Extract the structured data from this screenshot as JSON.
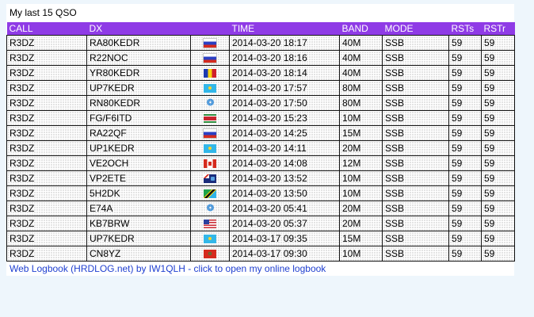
{
  "title": "My last 15 QSO",
  "headers": [
    "CALL",
    "DX",
    "",
    "TIME",
    "BAND",
    "MODE",
    "RSTs",
    "RSTr"
  ],
  "rows": [
    {
      "call": "R3DZ",
      "dx": "RA80KEDR",
      "flag": "flag-russia",
      "time": "2014-03-20 18:17",
      "band": "40M",
      "mode": "SSB",
      "rsts": "59",
      "rstr": "59"
    },
    {
      "call": "R3DZ",
      "dx": "R22NOC",
      "flag": "flag-russia",
      "time": "2014-03-20 18:16",
      "band": "40M",
      "mode": "SSB",
      "rsts": "59",
      "rstr": "59"
    },
    {
      "call": "R3DZ",
      "dx": "YR80KEDR",
      "flag": "flag-romania",
      "time": "2014-03-20 18:14",
      "band": "40M",
      "mode": "SSB",
      "rsts": "59",
      "rstr": "59"
    },
    {
      "call": "R3DZ",
      "dx": "UP7KEDR",
      "flag": "flag-kazakhstan",
      "time": "2014-03-20 17:57",
      "band": "80M",
      "mode": "SSB",
      "rsts": "59",
      "rstr": "59"
    },
    {
      "call": "R3DZ",
      "dx": "RN80KEDR",
      "flag": "flag-un",
      "time": "2014-03-20 17:50",
      "band": "80M",
      "mode": "SSB",
      "rsts": "59",
      "rstr": "59"
    },
    {
      "call": "R3DZ",
      "dx": "FG/F6ITD",
      "flag": "flag-suriname",
      "time": "2014-03-20 15:23",
      "band": "10M",
      "mode": "SSB",
      "rsts": "59",
      "rstr": "59"
    },
    {
      "call": "R3DZ",
      "dx": "RA22QF",
      "flag": "flag-russia",
      "time": "2014-03-20 14:25",
      "band": "15M",
      "mode": "SSB",
      "rsts": "59",
      "rstr": "59"
    },
    {
      "call": "R3DZ",
      "dx": "UP1KEDR",
      "flag": "flag-kazakhstan",
      "time": "2014-03-20 14:11",
      "band": "20M",
      "mode": "SSB",
      "rsts": "59",
      "rstr": "59"
    },
    {
      "call": "R3DZ",
      "dx": "VE2OCH",
      "flag": "flag-canada",
      "time": "2014-03-20 14:08",
      "band": "12M",
      "mode": "SSB",
      "rsts": "59",
      "rstr": "59"
    },
    {
      "call": "R3DZ",
      "dx": "VP2ETE",
      "flag": "flag-caribbean",
      "time": "2014-03-20 13:52",
      "band": "10M",
      "mode": "SSB",
      "rsts": "59",
      "rstr": "59"
    },
    {
      "call": "R3DZ",
      "dx": "5H2DK",
      "flag": "flag-tanzania",
      "time": "2014-03-20 13:50",
      "band": "10M",
      "mode": "SSB",
      "rsts": "59",
      "rstr": "59"
    },
    {
      "call": "R3DZ",
      "dx": "E74A",
      "flag": "flag-un",
      "time": "2014-03-20 05:41",
      "band": "20M",
      "mode": "SSB",
      "rsts": "59",
      "rstr": "59"
    },
    {
      "call": "R3DZ",
      "dx": "KB7BRW",
      "flag": "flag-usa",
      "time": "2014-03-20 05:37",
      "band": "20M",
      "mode": "SSB",
      "rsts": "59",
      "rstr": "59"
    },
    {
      "call": "R3DZ",
      "dx": "UP7KEDR",
      "flag": "flag-kazakhstan",
      "time": "2014-03-17 09:35",
      "band": "15M",
      "mode": "SSB",
      "rsts": "59",
      "rstr": "59"
    },
    {
      "call": "R3DZ",
      "dx": "CN8YZ",
      "flag": "flag-morocco",
      "time": "2014-03-17 09:30",
      "band": "10M",
      "mode": "SSB",
      "rsts": "59",
      "rstr": "59"
    }
  ],
  "un_glyph": "❂",
  "footer_link": "Web Logbook (HRDLOG.net) by IW1QLH - click to open my online logbook",
  "colors": {
    "header_bg": "#8f3be6",
    "link": "#1f3fd0",
    "page_bg": "#eef6fc"
  }
}
